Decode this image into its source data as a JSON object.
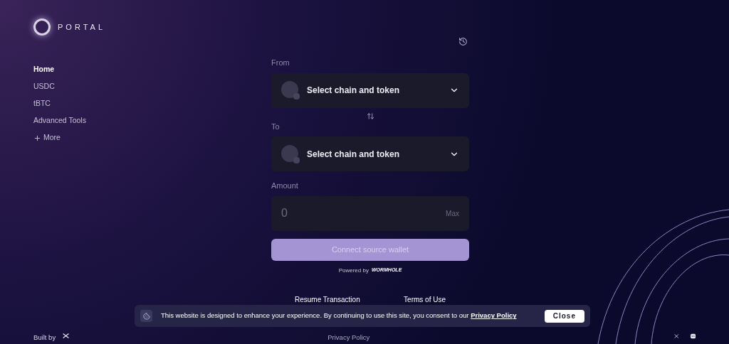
{
  "logo": {
    "text": "PORTAL"
  },
  "nav": [
    {
      "label": "Home",
      "selected": true
    },
    {
      "label": "USDC",
      "selected": false
    },
    {
      "label": "tBTC",
      "selected": false
    },
    {
      "label": "Advanced Tools",
      "selected": false
    },
    {
      "label": "More",
      "selected": false,
      "kind": "expand"
    }
  ],
  "form": {
    "from": {
      "label": "From",
      "placeholder": "Select chain and token"
    },
    "to": {
      "label": "To",
      "placeholder": "Select chain and token"
    },
    "amount": {
      "label": "Amount",
      "placeholder": "0",
      "max": "Max"
    },
    "submit": {
      "label": "Connect source wallet",
      "disabled": true
    },
    "powered_by": {
      "text": "Powered by",
      "brand": "WORMHOLE"
    }
  },
  "links": [
    "Resume Transaction",
    "Terms of Use"
  ],
  "cookie_banner": {
    "message": "This website is designed to enhance your experience. By continuing to use this site, you consent to our",
    "link": "Privacy Policy",
    "close": "Close"
  },
  "footer": {
    "built_by": "Built by",
    "privacy": "Privacy Policy"
  }
}
